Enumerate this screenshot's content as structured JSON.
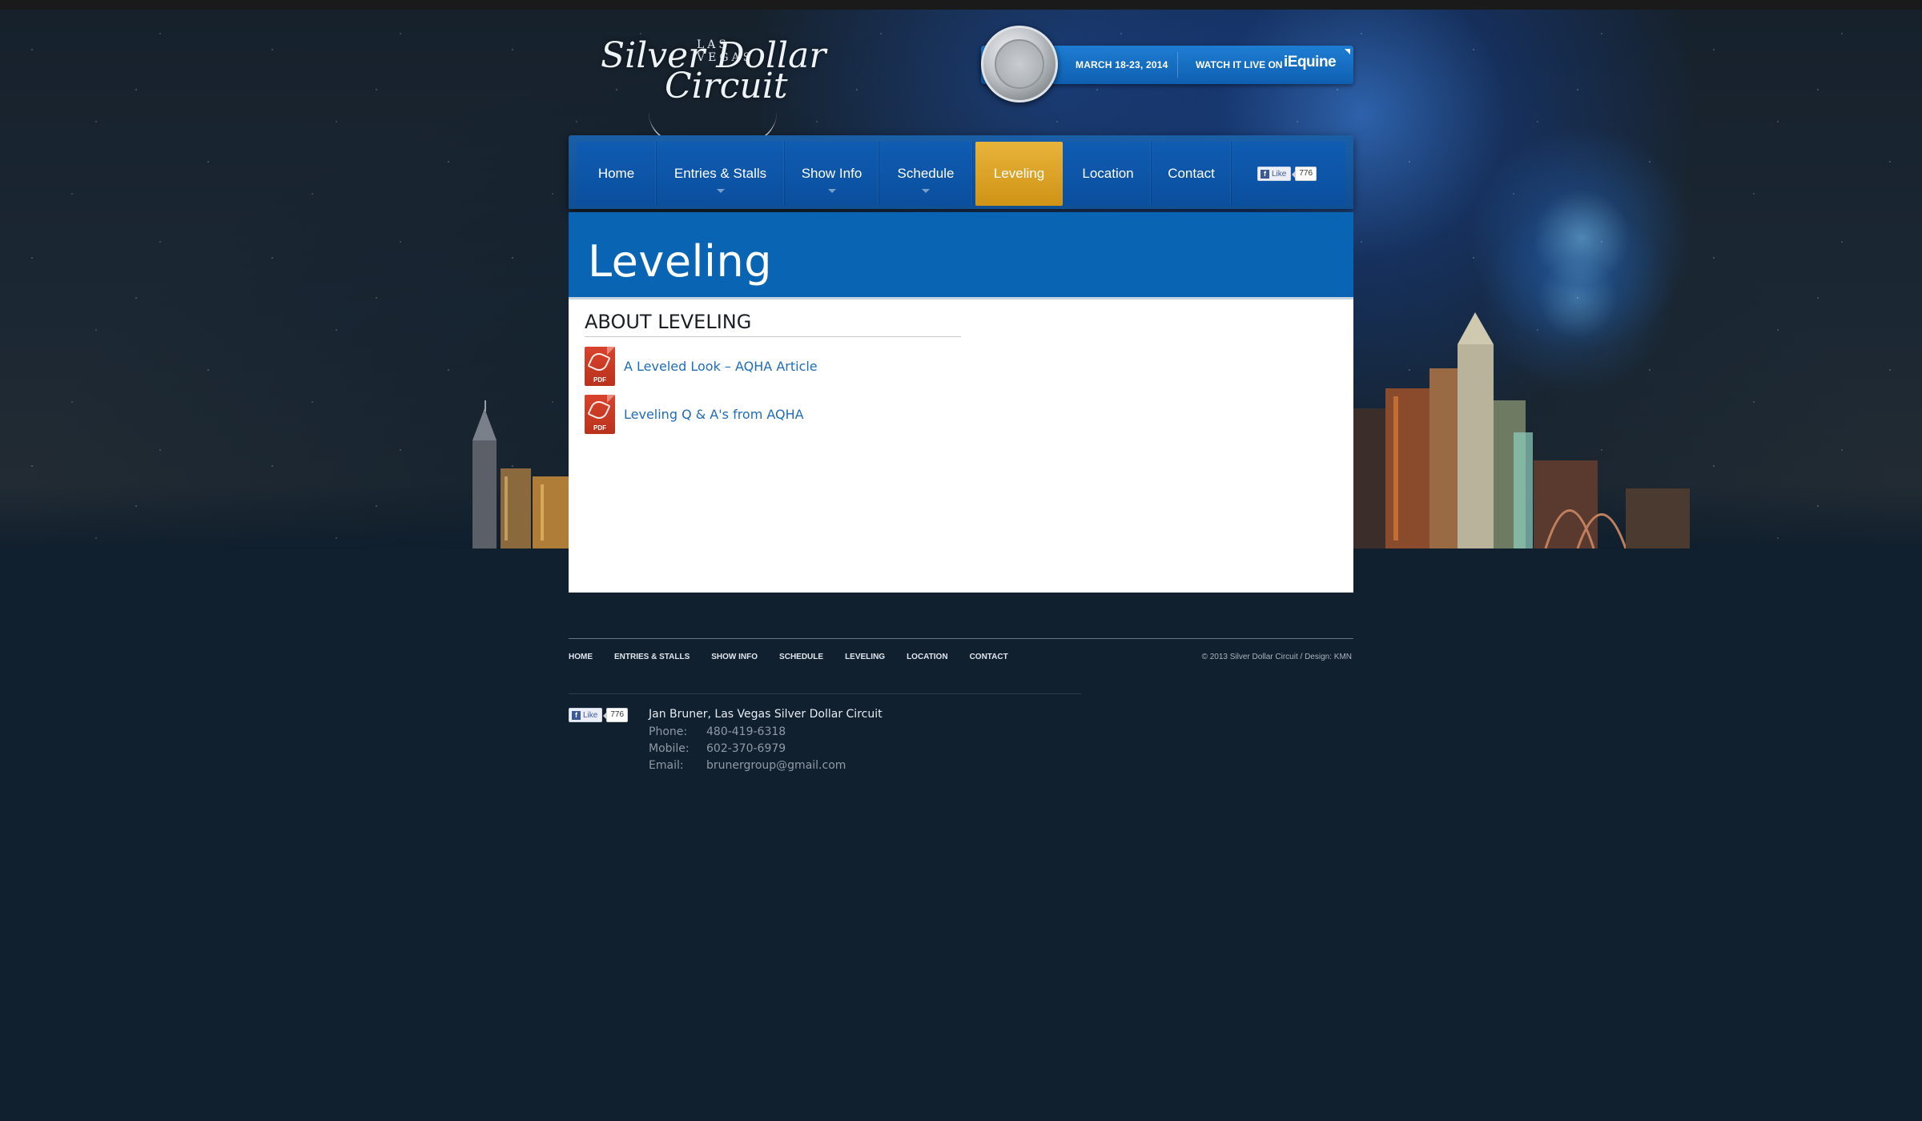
{
  "header": {
    "logo_top": "LAS VEGAS",
    "logo_line1": "Silver Dollar",
    "logo_line2": "Circuit",
    "event_dates": "MARCH 18-23, 2014",
    "watch_label": "WATCH IT LIVE ON",
    "stream_brand": "iEquine"
  },
  "nav": {
    "items": [
      {
        "label": "Home",
        "has_dropdown": false
      },
      {
        "label": "Entries & Stalls",
        "has_dropdown": true
      },
      {
        "label": "Show Info",
        "has_dropdown": true
      },
      {
        "label": "Schedule",
        "has_dropdown": true
      },
      {
        "label": "Leveling",
        "has_dropdown": false,
        "active": true
      },
      {
        "label": "Location",
        "has_dropdown": false
      },
      {
        "label": "Contact",
        "has_dropdown": false
      }
    ],
    "fb_like": {
      "label": "Like",
      "count": "776"
    }
  },
  "page": {
    "title": "Leveling",
    "section_heading": "ABOUT LEVELING",
    "documents": [
      {
        "label": "A Leveled Look – AQHA Article",
        "icon": "pdf-icon",
        "icon_text": "PDF"
      },
      {
        "label": "Leveling Q & A's from AQHA",
        "icon": "pdf-icon",
        "icon_text": "PDF"
      }
    ]
  },
  "footer": {
    "nav": [
      "HOME",
      "ENTRIES & STALLS",
      "SHOW INFO",
      "SCHEDULE",
      "LEVELING",
      "LOCATION",
      "CONTACT"
    ],
    "copyright": "© 2013 Silver Dollar Circuit   /   Design: KMN",
    "fb_like": {
      "label": "Like",
      "count": "776"
    },
    "contact": {
      "name": "Jan Bruner, Las Vegas Silver Dollar Circuit",
      "phone_label": "Phone:",
      "phone": "480-419-6318",
      "mobile_label": "Mobile:",
      "mobile": "602-370-6979",
      "email_label": "Email:",
      "email": "brunergroup@gmail.com"
    }
  },
  "colors": {
    "page_bg": "#11202e",
    "nav_blue": "#0f5cb3",
    "active_gold": "#e0a52a",
    "title_band": "#0a64b4",
    "link_blue": "#1f6cb8"
  }
}
